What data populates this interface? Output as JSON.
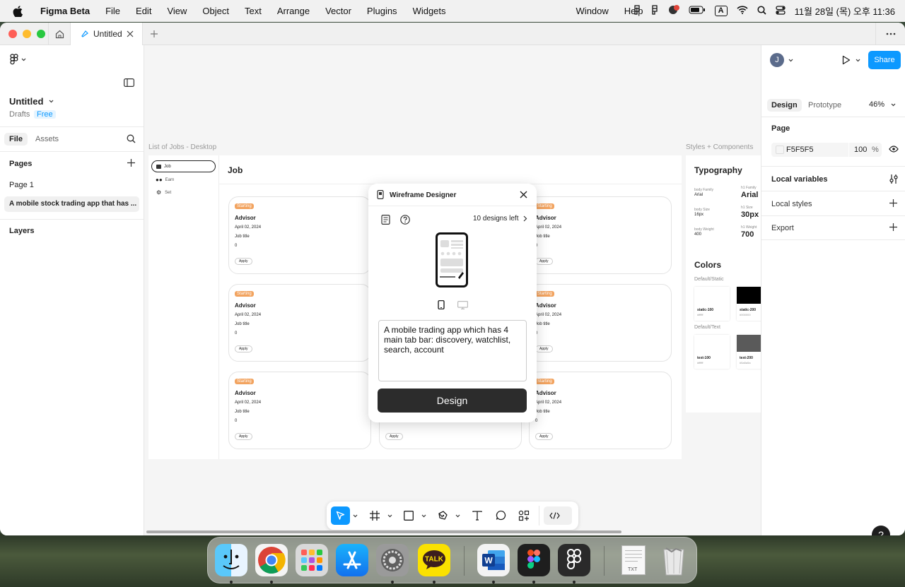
{
  "menubar": {
    "app": "Figma Beta",
    "items": [
      "File",
      "Edit",
      "View",
      "Object",
      "Text",
      "Arrange",
      "Vector",
      "Plugins",
      "Widgets",
      "Window",
      "Help"
    ],
    "clock": "11월 28일 (목) 오후 11:36",
    "input_indicator": "A"
  },
  "tabs": {
    "active_label": "Untitled"
  },
  "left": {
    "file_title": "Untitled",
    "drafts": "Drafts",
    "plan": "Free",
    "tab_file": "File",
    "tab_assets": "Assets",
    "pages_heading": "Pages",
    "pages": [
      "Page 1",
      "A mobile stock trading app that has ..."
    ],
    "layers_heading": "Layers"
  },
  "right": {
    "avatar": "J",
    "share": "Share",
    "tab_design": "Design",
    "tab_prototype": "Prototype",
    "zoom": "46%",
    "page_heading": "Page",
    "page_color": "F5F5F5",
    "page_opacity": "100",
    "percent": "%",
    "local_variables": "Local variables",
    "local_styles": "Local styles",
    "export": "Export"
  },
  "canvas": {
    "frame1_label": "List of Jobs - Desktop",
    "frame2_label": "Styles + Components",
    "nav": [
      "Job",
      "Earn",
      "Set"
    ],
    "header": "Job",
    "card": {
      "badge": "Starting",
      "title": "Advisor",
      "date": "April 02, 2024",
      "job": "Job title",
      "count": "0",
      "apply": "Apply"
    },
    "typography": {
      "heading": "Typography",
      "body_family_label": "body Family",
      "body_family": "Arial",
      "h1_family_label": "h1 Family",
      "h1_family": "Arial",
      "body_size_label": "body Size",
      "body_size": "16px",
      "h1_size_label": "h1 Size",
      "h1_size": "30px",
      "body_weight_label": "body Weight",
      "body_weight": "400",
      "h1_weight_label": "h1 Weight",
      "h1_weight": "700"
    },
    "colors": {
      "heading": "Colors",
      "group1": "Default/Static",
      "group2": "Default/Text",
      "swatches": [
        {
          "name": "static-100",
          "hex": "#ffffff"
        },
        {
          "name": "static-200",
          "hex": "#000000"
        },
        {
          "name": "text-100",
          "hex": "#ffffff"
        },
        {
          "name": "text-200",
          "hex": "#5a5a5a"
        }
      ]
    }
  },
  "modal": {
    "title": "Wireframe Designer",
    "designs_left": "10 designs left",
    "prompt": "A mobile trading app which has 4 main tab bar: discovery, watchlist, search, account",
    "button": "Design"
  },
  "help": "?",
  "dock_badge": "TXT",
  "colors": {
    "accent": "#0d99ff",
    "badge": "#f2a35f"
  }
}
